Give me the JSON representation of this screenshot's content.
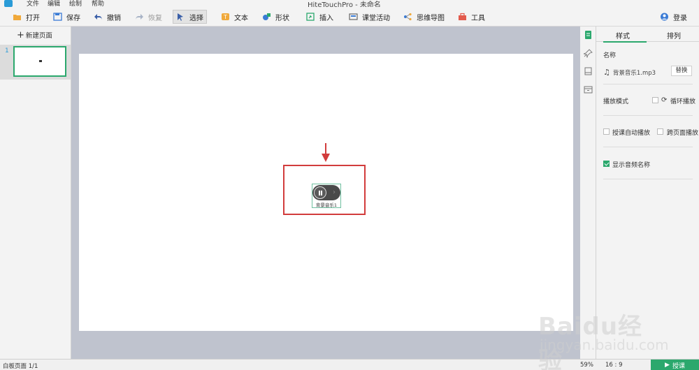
{
  "menubar": {
    "items": [
      "文件",
      "编辑",
      "绘制",
      "帮助"
    ],
    "title": "HiteTouchPro - 未命名"
  },
  "toolbar": {
    "open": "打开",
    "save": "保存",
    "undo": "撤销",
    "redo": "恢复",
    "select": "选择",
    "text": "文本",
    "shape": "形状",
    "insert": "插入",
    "activity": "课堂活动",
    "mindmap": "思维导图",
    "tools": "工具",
    "login": "登录"
  },
  "left_panel": {
    "new_page": "新建页面",
    "pages": [
      {
        "number": "1"
      }
    ]
  },
  "canvas": {
    "audio_widget": {
      "name": "背景音乐1"
    }
  },
  "right_panel": {
    "tabs": [
      "样式",
      "排列"
    ],
    "active_tab": 0,
    "name_label": "名称",
    "file_name": "背景音乐1.mp3",
    "replace_button": "替换",
    "play_mode_label": "播放模式",
    "loop_label": "循环播放",
    "loop_checked": false,
    "autoplay_label": "授课自动播放",
    "autoplay_checked": false,
    "cross_page_label": "跨页面播放",
    "cross_page_checked": false,
    "show_name_label": "显示音频名称",
    "show_name_checked": true
  },
  "statusbar": {
    "page_info": "白板页面 1/1",
    "zoom": "59%",
    "ratio": "16 : 9",
    "teach_button": "授课"
  },
  "watermark": {
    "main": "Baidu经验",
    "sub": "jingyan.baidu.com"
  },
  "colors": {
    "accent": "#2ba86d",
    "highlight": "#d23c3c",
    "canvas_bg": "#bfc3ce"
  }
}
